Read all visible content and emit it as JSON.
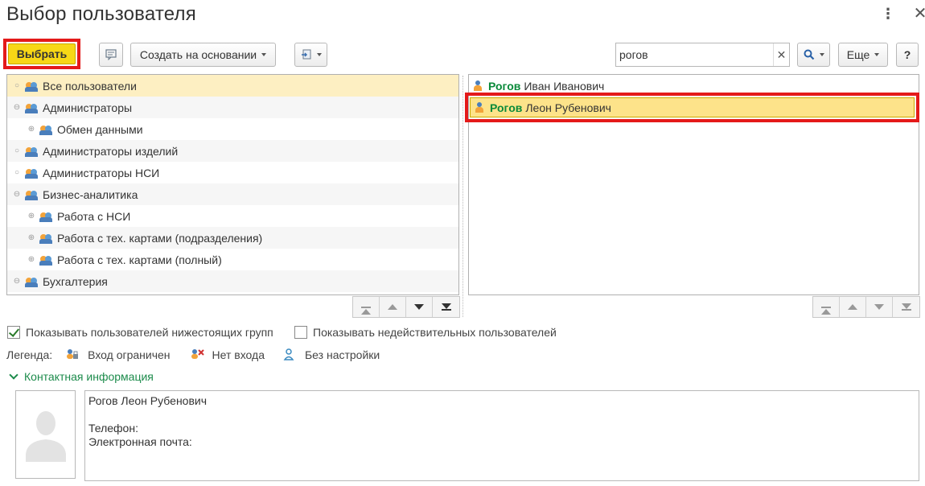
{
  "window": {
    "title": "Выбор пользователя",
    "more_icon": "more-vert-icon",
    "close_icon": "close-icon"
  },
  "toolbar": {
    "select_label": "Выбрать",
    "comment_icon": "comment-icon",
    "create_based_label": "Создать на основании",
    "import_icon": "import-icon",
    "search": {
      "value": "рогов",
      "placeholder": ""
    },
    "more_label": "Еще",
    "help_label": "?"
  },
  "groups": [
    {
      "label": "Все пользователи",
      "marker": "○",
      "level": 0,
      "selected": true
    },
    {
      "label": "Администраторы",
      "marker": "⊖",
      "level": 0
    },
    {
      "label": "Обмен данными",
      "marker": "⊕",
      "level": 1
    },
    {
      "label": "Администраторы изделий",
      "marker": "○",
      "level": 0
    },
    {
      "label": "Администраторы НСИ",
      "marker": "○",
      "level": 0
    },
    {
      "label": "Бизнес-аналитика",
      "marker": "⊖",
      "level": 0
    },
    {
      "label": "Работа с НСИ",
      "marker": "⊕",
      "level": 1
    },
    {
      "label": "Работа с тех. картами (подразделения)",
      "marker": "⊕",
      "level": 1
    },
    {
      "label": "Работа с тех. картами (полный)",
      "marker": "⊕",
      "level": 1
    },
    {
      "label": "Бухгалтерия",
      "marker": "⊖",
      "level": 0
    }
  ],
  "users": [
    {
      "match": "Рогов",
      "rest": "Иван Иванович",
      "selected": false
    },
    {
      "match": "Рогов",
      "rest": "Леон Рубенович",
      "selected": true
    }
  ],
  "options": {
    "show_subgroups_label": "Показывать пользователей нижестоящих групп",
    "show_subgroups_checked": true,
    "show_invalid_label": "Показывать недействительных пользователей",
    "show_invalid_checked": false
  },
  "legend": {
    "label": "Легенда:",
    "items": [
      {
        "icon": "login-restricted-icon",
        "label": "Вход ограничен"
      },
      {
        "icon": "no-login-icon",
        "label": "Нет входа"
      },
      {
        "icon": "no-setup-icon",
        "label": "Без настройки"
      }
    ]
  },
  "contact": {
    "section_label": "Контактная информация",
    "name": "Рогов Леон Рубенович",
    "phone_label": "Телефон:",
    "email_label": "Электронная почта:"
  },
  "colors": {
    "accent_yellow": "#f7d716",
    "highlight_red": "#e41a1a",
    "match_green": "#0a8a3a",
    "section_green": "#1c8b4b"
  }
}
